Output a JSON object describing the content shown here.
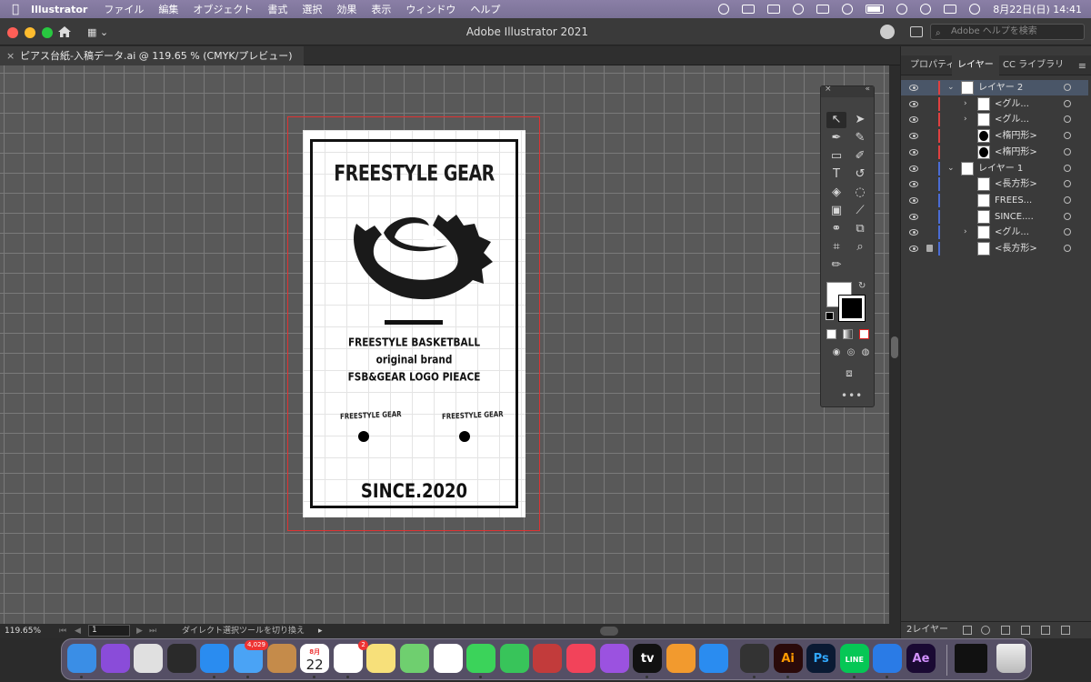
{
  "menubar": {
    "app_name": "Illustrator",
    "items": [
      "ファイル",
      "編集",
      "オブジェクト",
      "書式",
      "選択",
      "効果",
      "表示",
      "ウィンドウ",
      "ヘルプ"
    ],
    "datetime": "8月22日(日)  14:41"
  },
  "titlebar": {
    "title": "Adobe Illustrator 2021",
    "search_placeholder": "Adobe ヘルプを検索"
  },
  "document_tab": {
    "label": "ピアス台紙-入稿データ.ai @ 119.65 % (CMYK/プレビュー)"
  },
  "artwork": {
    "logo_title": "FREESTYLE GEAR",
    "line1": "FREESTYLE BASKETBALL",
    "line2": "original brand",
    "line3": "FSB&GEAR LOGO PIEACE",
    "small_logo_left": "FREESTYLE GEAR",
    "small_logo_right": "FREESTYLE GEAR",
    "since": "SINCE.2020"
  },
  "statusbar": {
    "zoom": "119.65%",
    "page": "1",
    "status_text": "ダイレクト選択ツールを切り換え"
  },
  "panel": {
    "tabs": [
      "プロパティ",
      "レイヤー",
      "CC ライブラリ"
    ],
    "active_tab": "レイヤー",
    "layers": [
      {
        "label": "レイヤー 2",
        "level": 0,
        "expanded": true,
        "color": "#e04040"
      },
      {
        "label": "<グル...",
        "level": 1,
        "color": "#e04040"
      },
      {
        "label": "<グル...",
        "level": 1,
        "color": "#e04040"
      },
      {
        "label": "<楕円形>",
        "level": 1,
        "color": "#e04040"
      },
      {
        "label": "<楕円形>",
        "level": 1,
        "color": "#e04040"
      },
      {
        "label": "レイヤー 1",
        "level": 0,
        "expanded": true,
        "color": "#4a6cd4"
      },
      {
        "label": "<長方形>",
        "level": 1,
        "color": "#4a6cd4"
      },
      {
        "label": "FREES...",
        "level": 1,
        "color": "#4a6cd4"
      },
      {
        "label": "SINCE....",
        "level": 1,
        "color": "#4a6cd4"
      },
      {
        "label": "<グル...",
        "level": 1,
        "color": "#4a6cd4"
      },
      {
        "label": "<長方形>",
        "level": 1,
        "color": "#4a6cd4",
        "locked": true
      }
    ],
    "footer_count": "2レイヤー"
  },
  "dock": {
    "mail_badge": "4,029",
    "reminders_badge": "2",
    "calendar_month": "8月",
    "calendar_day": "22",
    "apps": [
      "Finder",
      "Siri",
      "Launchpad",
      "Mission Control",
      "Safari",
      "Mail",
      "Contacts",
      "Calendar",
      "Reminders",
      "Notes",
      "Maps",
      "Photos",
      "Messages",
      "FaceTime",
      "Photo Booth",
      "Music",
      "Podcasts",
      "TV",
      "Books",
      "App Store",
      "GarageBand",
      "Illustrator",
      "Photoshop",
      "LINE",
      "Dropbox",
      "After Effects"
    ],
    "ai_label": "Ai",
    "ps_label": "Ps",
    "ae_label": "Ae",
    "tv_label": "tv",
    "line_label": "LINE"
  }
}
